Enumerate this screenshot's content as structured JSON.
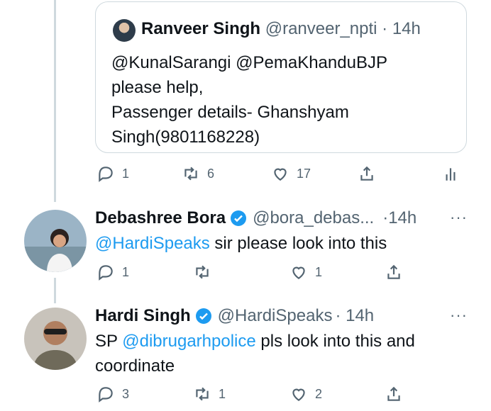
{
  "quoted": {
    "name": "Ranveer Singh",
    "handle": "@ranveer_npti",
    "time": "· 14h",
    "lines": [
      "@KunalSarangi @PemaKhanduBJP",
      "please help,",
      "Passenger details- Ghanshyam",
      "Singh(9801168228)"
    ]
  },
  "tweet1_actions": {
    "reply_count": "1",
    "retweet_count": "6",
    "like_count": "17"
  },
  "tweet2": {
    "name": "Debashree Bora",
    "handle": "@bora_debas...",
    "time": "·14h",
    "more": "···",
    "mention": "@HardiSpeaks",
    "text": " sir please look into this",
    "reply_count": "1",
    "retweet_count": "",
    "like_count": "1"
  },
  "tweet3": {
    "name": "Hardi Singh",
    "handle": "@HardiSpeaks",
    "time": "· 14h",
    "more": "···",
    "prefix": "SP ",
    "mention": "@dibrugarhpolice",
    "text": " pls look into this and",
    "line2": "coordinate",
    "reply_count": "3",
    "retweet_count": "1",
    "like_count": "2"
  },
  "colors": {
    "link": "#1d9bf0",
    "verified": "#1d9bf0",
    "muted": "#536471",
    "border": "#cfd9de"
  },
  "icons": [
    "reply-icon",
    "retweet-icon",
    "like-icon",
    "share-icon",
    "analytics-icon",
    "verified-badge-icon",
    "more-icon"
  ]
}
